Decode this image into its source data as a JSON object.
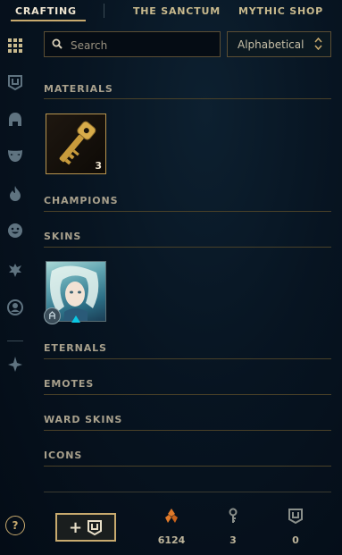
{
  "tabs": [
    {
      "label": "CRAFTING",
      "active": true
    },
    {
      "label": "THE SANCTUM",
      "active": false
    },
    {
      "label": "MYTHIC SHOP",
      "active": false
    }
  ],
  "sidebar": {
    "icons": [
      "grid-icon",
      "chest-icon",
      "helmet-icon",
      "mask-icon",
      "flame-icon",
      "emote-face-icon",
      "ward-icon",
      "profile-icon",
      "eternals-icon"
    ]
  },
  "search": {
    "placeholder": "Search",
    "value": ""
  },
  "sort": {
    "selected": "Alphabetical"
  },
  "sections": {
    "materials": "MATERIALS",
    "champions": "CHAMPIONS",
    "skins": "SKINS",
    "eternals": "ETERNALS",
    "emotes": "EMOTES",
    "ward_skins": "WARD SKINS",
    "icons": "ICONS"
  },
  "materials": {
    "key": {
      "icon": "key-icon",
      "count": "3"
    }
  },
  "skins": {
    "first": {
      "icon": "champion-skin-portrait"
    }
  },
  "footer": {
    "help_label": "?",
    "add_label": "+",
    "currencies": [
      {
        "icon": "orange-essence-icon",
        "value": "6124",
        "color": "#e07a2a"
      },
      {
        "icon": "key-fragment-icon",
        "value": "3",
        "color": "#8a8f8a"
      },
      {
        "icon": "chest-icon",
        "value": "0",
        "color": "#8a8f8a"
      }
    ]
  },
  "colors": {
    "accent_gold": "#c8aa6e",
    "background": "#071421",
    "text": "#a8a08c"
  }
}
